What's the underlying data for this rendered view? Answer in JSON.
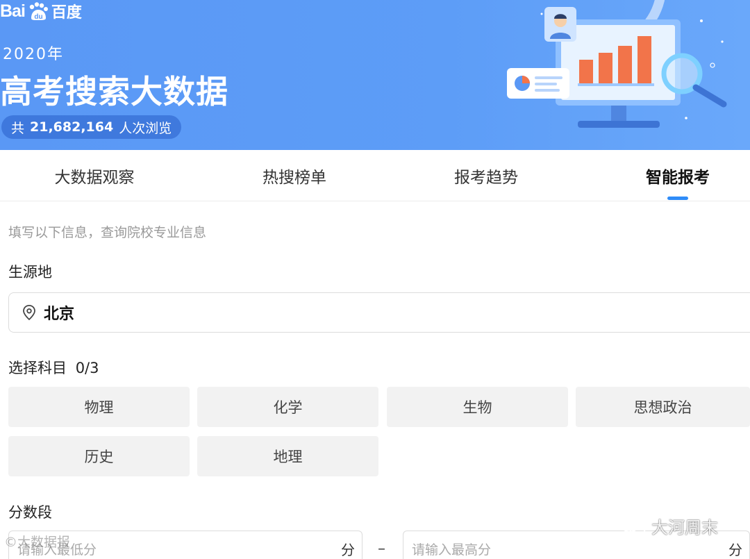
{
  "banner": {
    "logo_bai": "Bai",
    "logo_cn": "百度",
    "year": "2020年",
    "title": "高考搜索大数据",
    "views_prefix": "共",
    "views_count": "21,682,164",
    "views_suffix": "人次浏览"
  },
  "tabs": [
    {
      "label": "大数据观察",
      "active": false
    },
    {
      "label": "热搜榜单",
      "active": false
    },
    {
      "label": "报考趋势",
      "active": false
    },
    {
      "label": "智能报考",
      "active": true
    }
  ],
  "form": {
    "hint": "填写以下信息，查询院校专业信息",
    "origin_label": "生源地",
    "origin_value": "北京",
    "subjects_label": "选择科目",
    "subjects_count": "0/3",
    "subjects": [
      "物理",
      "化学",
      "生物",
      "思想政治",
      "历史",
      "地理"
    ],
    "score_label": "分数段",
    "min_placeholder": "请输入最低分",
    "max_placeholder": "请输入最高分",
    "unit": "分",
    "separator": "–"
  },
  "watermarks": {
    "wechat_name": "大河周末",
    "corner": "©大数据报"
  },
  "colors": {
    "banner_blue": "#5a98f5",
    "accent": "#2f8cf8",
    "chip_bg": "#f2f2f2"
  }
}
